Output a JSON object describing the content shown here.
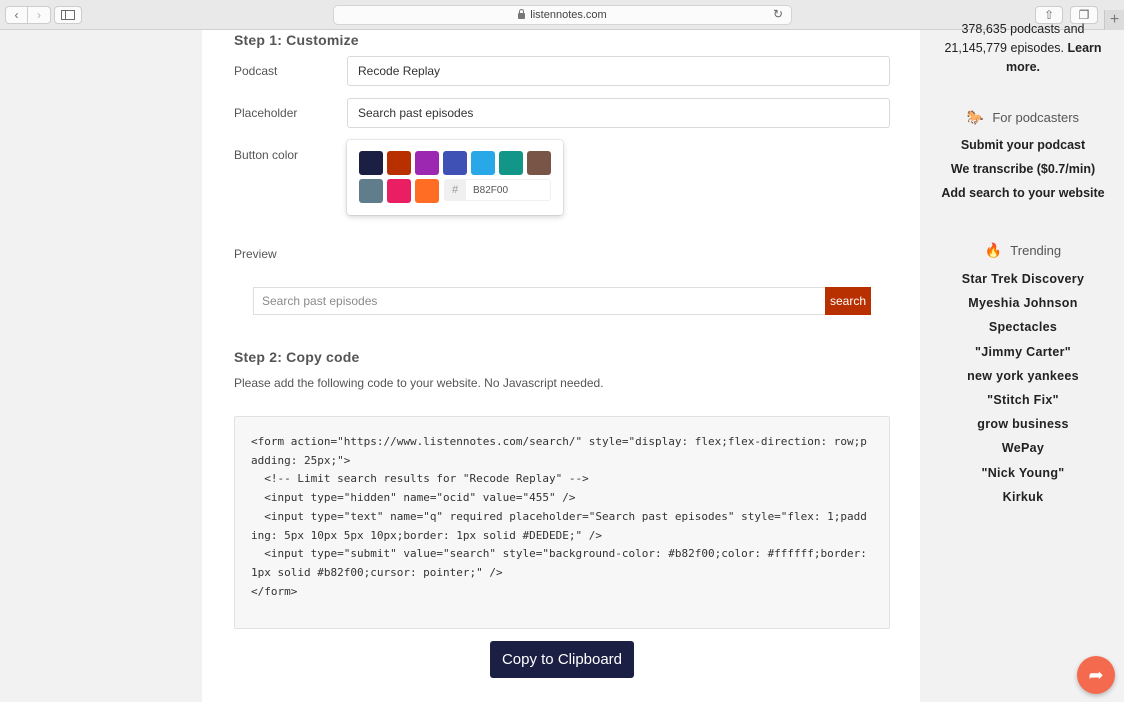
{
  "browser": {
    "url": "listennotes.com",
    "back_glyph": "‹",
    "forward_glyph": "›",
    "reload_glyph": "↻",
    "share_glyph": "⇧",
    "tabs_glyph": "❐",
    "newtab_glyph": "+"
  },
  "step1": {
    "title": "Step 1: Customize",
    "podcast_label": "Podcast",
    "podcast_value": "Recode Replay",
    "placeholder_label": "Placeholder",
    "placeholder_value": "Search past episodes",
    "button_color_label": "Button color",
    "swatches_row1": [
      "#1b1f44",
      "#b82f00",
      "#9c27b0",
      "#3f51b5",
      "#29a8e8",
      "#129688",
      "#795548"
    ],
    "swatches_row2": [
      "#5f7d8b",
      "#e91e63",
      "#ff6d24"
    ],
    "hash_symbol": "#",
    "hex_value": "B82F00"
  },
  "preview": {
    "label": "Preview",
    "input_placeholder": "Search past episodes",
    "button_label": "search",
    "button_color": "#b82f00"
  },
  "step2": {
    "title": "Step 2: Copy code",
    "description": "Please add the following code to your website. No Javascript needed.",
    "code": "<form action=\"https://www.listennotes.com/search/\" style=\"display: flex;flex-direction: row;padding: 25px;\">\n  <!-- Limit search results for \"Recode Replay\" -->\n  <input type=\"hidden\" name=\"ocid\" value=\"455\" />\n  <input type=\"text\" name=\"q\" required placeholder=\"Search past episodes\" style=\"flex: 1;padding: 5px 10px 5px 10px;border: 1px solid #DEDEDE;\" />\n  <input type=\"submit\" value=\"search\" style=\"background-color: #b82f00;color: #ffffff;border: 1px solid #b82f00;cursor: pointer;\" />\n</form>",
    "copy_button": "Copy to Clipboard"
  },
  "sidebar": {
    "stats_line1": "378,635 podcasts and",
    "stats_line2": "21,145,779 episodes.",
    "learn_more_1": "Learn",
    "learn_more_2": "more.",
    "for_podcasters_emoji": "🐎",
    "for_podcasters_title": "For podcasters",
    "podcaster_links": [
      "Submit your podcast",
      "We transcribe ($0.7/min)",
      "Add search to your website"
    ],
    "trending_emoji": "🔥",
    "trending_title": "Trending",
    "trending": [
      "Star Trek Discovery",
      "Myeshia Johnson",
      "Spectacles",
      "\"Jimmy Carter\"",
      "new york yankees",
      "\"Stitch Fix\"",
      "grow business",
      "WePay",
      "\"Nick Young\"",
      "Kirkuk"
    ]
  },
  "fab": {
    "glyph": "➦"
  }
}
